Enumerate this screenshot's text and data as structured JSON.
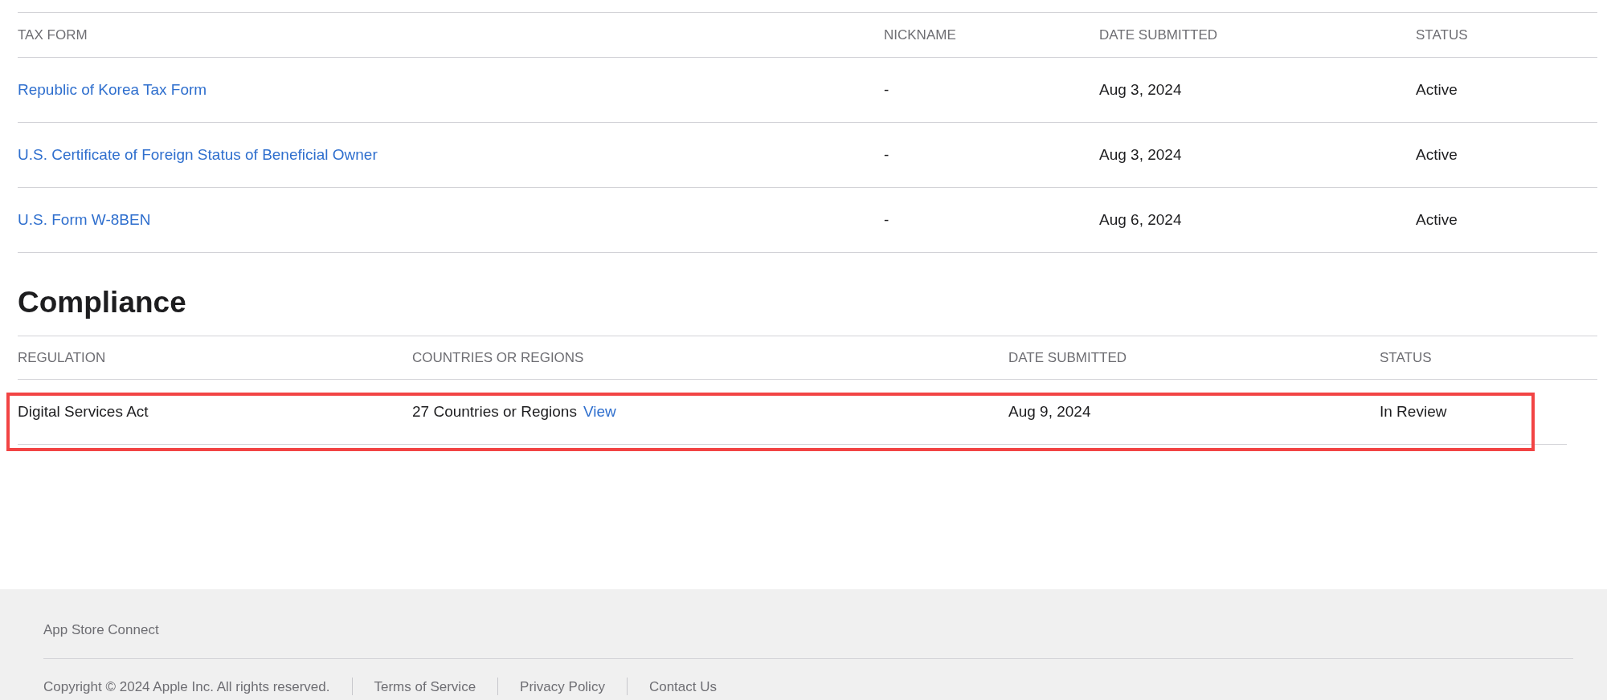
{
  "tax_forms": {
    "columns": [
      "TAX FORM",
      "NICKNAME",
      "DATE SUBMITTED",
      "STATUS"
    ],
    "rows": [
      {
        "form": "Republic of Korea Tax Form",
        "nickname": "-",
        "date_submitted": "Aug 3, 2024",
        "status": "Active"
      },
      {
        "form": "U.S. Certificate of Foreign Status of Beneficial Owner",
        "nickname": "-",
        "date_submitted": "Aug 3, 2024",
        "status": "Active"
      },
      {
        "form": "U.S. Form W-8BEN",
        "nickname": "-",
        "date_submitted": "Aug 6, 2024",
        "status": "Active"
      }
    ]
  },
  "compliance": {
    "title": "Compliance",
    "columns": [
      "REGULATION",
      "COUNTRIES OR REGIONS",
      "DATE SUBMITTED",
      "STATUS"
    ],
    "rows": [
      {
        "regulation": "Digital Services Act",
        "countries": "27 Countries or Regions",
        "countries_link": "View",
        "date_submitted": "Aug 9, 2024",
        "status": "In Review",
        "highlighted": true
      }
    ]
  },
  "footer": {
    "title": "App Store Connect",
    "copyright": "Copyright © 2024 Apple Inc. All rights reserved.",
    "links": [
      "Terms of Service",
      "Privacy Policy",
      "Contact Us"
    ]
  }
}
